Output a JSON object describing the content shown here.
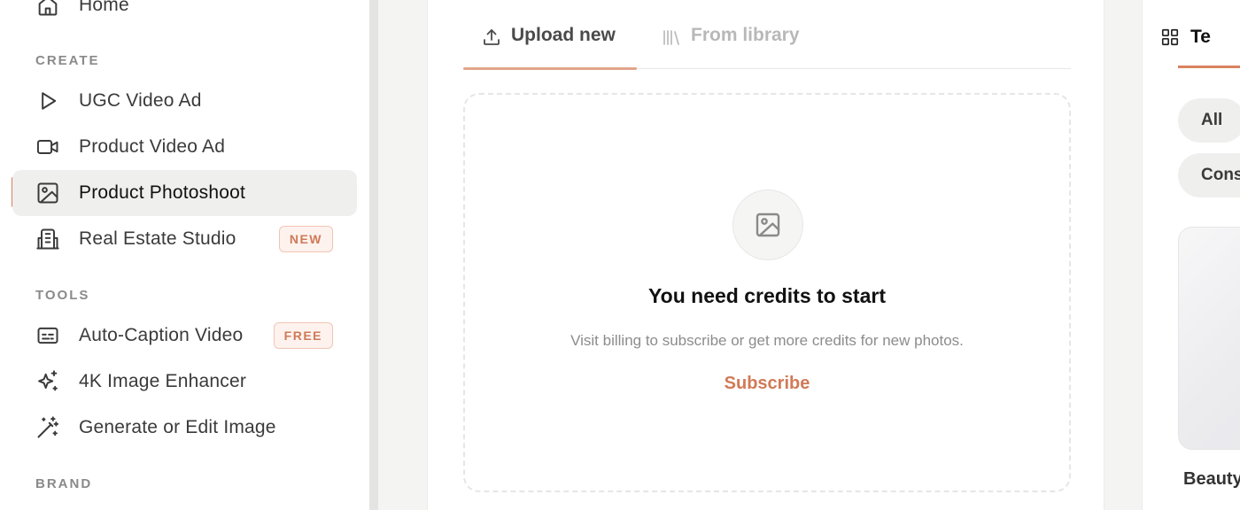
{
  "sidebar": {
    "home": {
      "label": "Home",
      "icon": "home-icon"
    },
    "sections": {
      "create": "CREATE",
      "tools": "TOOLS",
      "brand": "BRAND"
    },
    "create_items": [
      {
        "label": "UGC Video Ad",
        "icon": "play-icon"
      },
      {
        "label": "Product Video Ad",
        "icon": "video-camera-icon"
      },
      {
        "label": "Product Photoshoot",
        "icon": "image-icon",
        "active": true
      },
      {
        "label": "Real Estate Studio",
        "icon": "building-icon",
        "badge": "NEW"
      }
    ],
    "tools_items": [
      {
        "label": "Auto-Caption Video",
        "icon": "captions-icon",
        "badge": "FREE"
      },
      {
        "label": "4K Image Enhancer",
        "icon": "sparkles-icon"
      },
      {
        "label": "Generate or Edit Image",
        "icon": "magic-wand-icon"
      }
    ]
  },
  "main": {
    "tabs": [
      {
        "label": "Upload new",
        "icon": "upload-icon",
        "active": true
      },
      {
        "label": "From library",
        "icon": "library-icon",
        "active": false
      }
    ],
    "empty_state": {
      "icon": "image-icon",
      "title": "You need credits to start",
      "subtitle": "Visit billing to subscribe or get more credits for new photos.",
      "link": "Subscribe"
    }
  },
  "right_panel": {
    "tab_label": "Te",
    "tab_icon": "grid-icon",
    "chips": [
      "All",
      "Cons"
    ],
    "preview_label": "Beauty"
  },
  "colors": {
    "accent": "#d9825f",
    "badge_bg": "#fdf2ee",
    "badge_text": "#cf7a58",
    "active_item_bg": "#efefee"
  }
}
